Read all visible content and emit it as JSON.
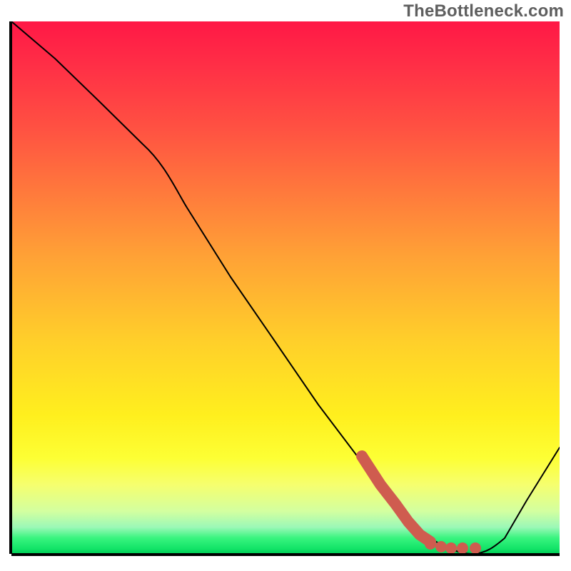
{
  "watermark": "TheBottleneck.com",
  "colors": {
    "curve": "#000000",
    "marker": "#cf5c4f",
    "axis": "#000000"
  },
  "chart_data": {
    "type": "line",
    "title": "",
    "xlabel": "",
    "ylabel": "",
    "xlim": [
      0,
      100
    ],
    "ylim": [
      0,
      100
    ],
    "legend": false,
    "grid": false,
    "background": "rainbow-vertical-gradient (red top → green bottom)",
    "series": [
      {
        "name": "curve",
        "color": "#000000",
        "x": [
          0,
          8,
          16,
          24,
          32,
          40,
          48,
          56,
          64,
          70,
          74,
          78,
          82,
          86,
          90,
          94,
          100
        ],
        "y": [
          100,
          93,
          85,
          77,
          65,
          52,
          40,
          28,
          17,
          10,
          5,
          2,
          0,
          0,
          3,
          10,
          20
        ]
      },
      {
        "name": "highlighted-segment",
        "color": "#cf5c4f",
        "style": "thick+dots",
        "x": [
          64,
          67,
          70,
          73,
          75,
          78,
          80,
          82,
          84
        ],
        "y": [
          17,
          12,
          9,
          5,
          3,
          2,
          1,
          1,
          1
        ]
      }
    ],
    "annotations": []
  }
}
